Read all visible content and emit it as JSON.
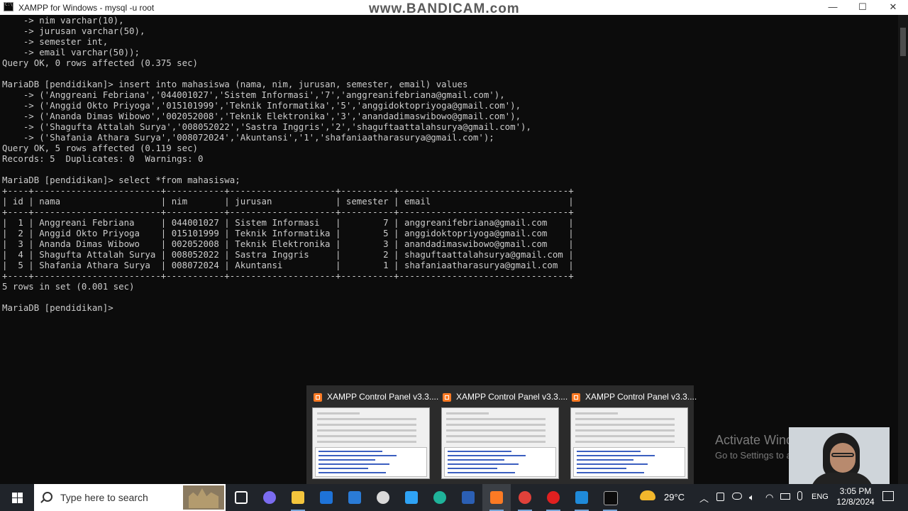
{
  "window": {
    "title": "XAMPP for Windows - mysql  -u root",
    "watermark": "www.BANDICAM.com",
    "controls": {
      "minimize": "—",
      "maximize": "☐",
      "close": "✕"
    }
  },
  "console": {
    "lines": [
      "    -> nim varchar(10),",
      "    -> jurusan varchar(50),",
      "    -> semester int,",
      "    -> email varchar(50));",
      "Query OK, 0 rows affected (0.375 sec)",
      "",
      "MariaDB [pendidikan]> insert into mahasiswa (nama, nim, jurusan, semester, email) values",
      "    -> ('Anggreani Febriana','044001027','Sistem Informasi','7','anggreanifebriana@gmail.com'),",
      "    -> ('Anggid Okto Priyoga','015101999','Teknik Informatika','5','anggidoktopriyoga@gmail.com'),",
      "    -> ('Ananda Dimas Wibowo','002052008','Teknik Elektronika','3','anandadimaswibowo@gmail.com'),",
      "    -> ('Shagufta Attalah Surya','008052022','Sastra Inggris','2','shaguftaattalahsurya@gmail.com'),",
      "    -> ('Shafania Athara Surya','008072024','Akuntansi','1','shafaniaatharasurya@gmail.com');",
      "Query OK, 5 rows affected (0.119 sec)",
      "Records: 5  Duplicates: 0  Warnings: 0",
      "",
      "MariaDB [pendidikan]> select *from mahasiswa;",
      "+----+------------------------+-----------+--------------------+----------+--------------------------------+",
      "| id | nama                   | nim       | jurusan            | semester | email                          |",
      "+----+------------------------+-----------+--------------------+----------+--------------------------------+",
      "|  1 | Anggreani Febriana     | 044001027 | Sistem Informasi   |        7 | anggreanifebriana@gmail.com    |",
      "|  2 | Anggid Okto Priyoga    | 015101999 | Teknik Informatika |        5 | anggidoktopriyoga@gmail.com    |",
      "|  3 | Ananda Dimas Wibowo    | 002052008 | Teknik Elektronika |        3 | anandadimaswibowo@gmail.com    |",
      "|  4 | Shagufta Attalah Surya | 008052022 | Sastra Inggris     |        2 | shaguftaattalahsurya@gmail.com |",
      "|  5 | Shafania Athara Surya  | 008072024 | Akuntansi          |        1 | shafaniaatharasurya@gmail.com  |",
      "+----+------------------------+-----------+--------------------+----------+--------------------------------+",
      "5 rows in set (0.001 sec)",
      "",
      "MariaDB [pendidikan]>"
    ]
  },
  "activation": {
    "title": "Activate Windows",
    "subtitle": "Go to Settings to activate Windows."
  },
  "thumbnails": [
    {
      "label": "XAMPP Control Panel v3.3...."
    },
    {
      "label": "XAMPP Control Panel v3.3...."
    },
    {
      "label": "XAMPP Control Panel v3.3...."
    }
  ],
  "taskbar": {
    "search_placeholder": "Type here to search",
    "weather": "29°C",
    "language": "ENG",
    "time": "3:05 PM",
    "date": "12/8/2024",
    "apps": [
      {
        "icon": "task-view-icon",
        "color": "#ffffff"
      },
      {
        "icon": "copilot-icon",
        "color": "#7b6cf0"
      },
      {
        "icon": "file-explorer-icon",
        "color": "#f4c53d"
      },
      {
        "icon": "bluetooth-icon",
        "color": "#1e73d8"
      },
      {
        "icon": "mail-icon",
        "color": "#2a7bd6"
      },
      {
        "icon": "timer-icon",
        "color": "#d9d9d9"
      },
      {
        "icon": "photoshop-icon",
        "color": "#2fa3f5"
      },
      {
        "icon": "edge-icon",
        "color": "#1fb39a"
      },
      {
        "icon": "word-icon",
        "color": "#2b5fb4"
      },
      {
        "icon": "xampp-icon",
        "color": "#fb7a24"
      },
      {
        "icon": "chrome-icon",
        "color": "#e0413a"
      },
      {
        "icon": "record-icon",
        "color": "#e02020"
      },
      {
        "icon": "vscode-icon",
        "color": "#1f8ad9"
      },
      {
        "icon": "terminal-icon",
        "color": "#0c0c0c"
      }
    ]
  }
}
